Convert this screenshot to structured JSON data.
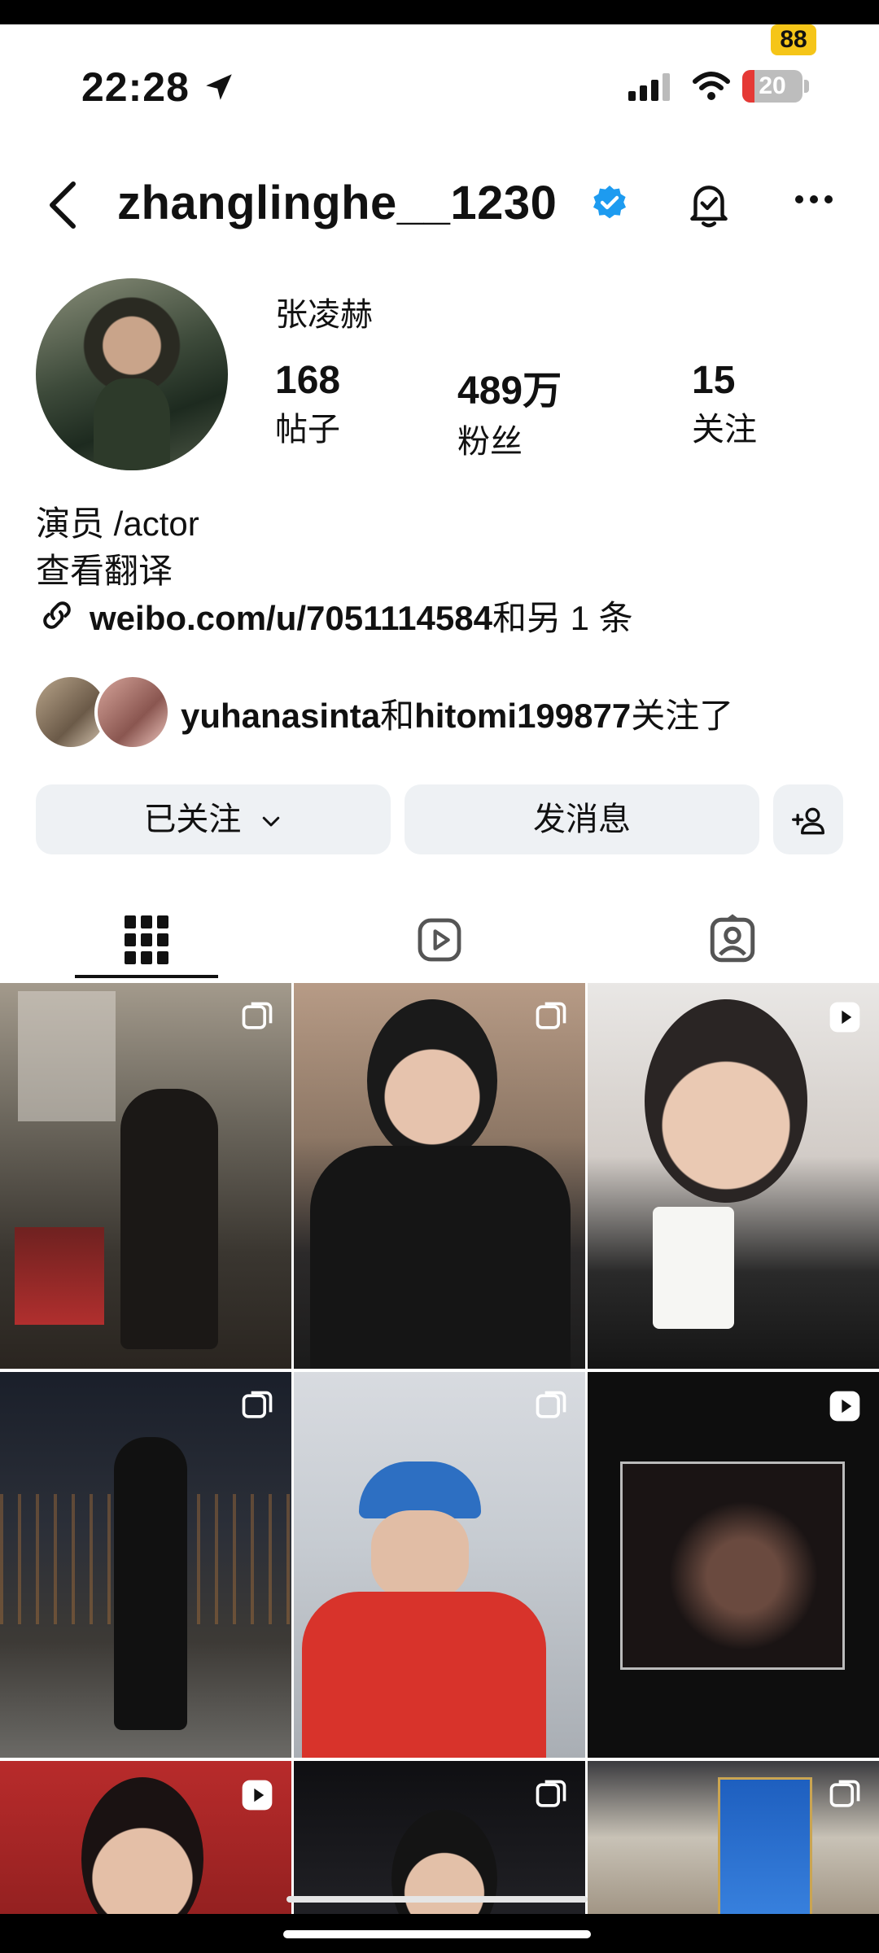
{
  "status_bar": {
    "time": "22:28",
    "battery": "20",
    "notification_badge": "88"
  },
  "header": {
    "username": "zhanglinghe__1230"
  },
  "profile": {
    "display_name": "张凌赫",
    "stats": [
      {
        "value": "168",
        "label": "帖子"
      },
      {
        "value": "489万",
        "label": "粉丝"
      },
      {
        "value": "15",
        "label": "关注"
      }
    ],
    "bio_line1": "演员 /actor",
    "translate": "查看翻译",
    "link": "weibo.com/u/7051114584",
    "link_more": "和另 1 条"
  },
  "mutual": {
    "user1": "yuhanasinta",
    "and": "和",
    "user2": "hitomi199877",
    "suffix": "关注了"
  },
  "actions": {
    "following": "已关注",
    "message": "发消息"
  },
  "tabs": [
    "grid-icon",
    "reels-icon",
    "tagged-icon"
  ],
  "colors": {
    "verified": "#1d9bf0",
    "battery_low": "#e53935",
    "button_bg": "#eef1f4"
  },
  "posts": [
    {
      "type": "carousel"
    },
    {
      "type": "carousel"
    },
    {
      "type": "reel"
    },
    {
      "type": "carousel"
    },
    {
      "type": "carousel"
    },
    {
      "type": "reel"
    },
    {
      "type": "reel"
    },
    {
      "type": "carousel"
    },
    {
      "type": "carousel"
    }
  ]
}
